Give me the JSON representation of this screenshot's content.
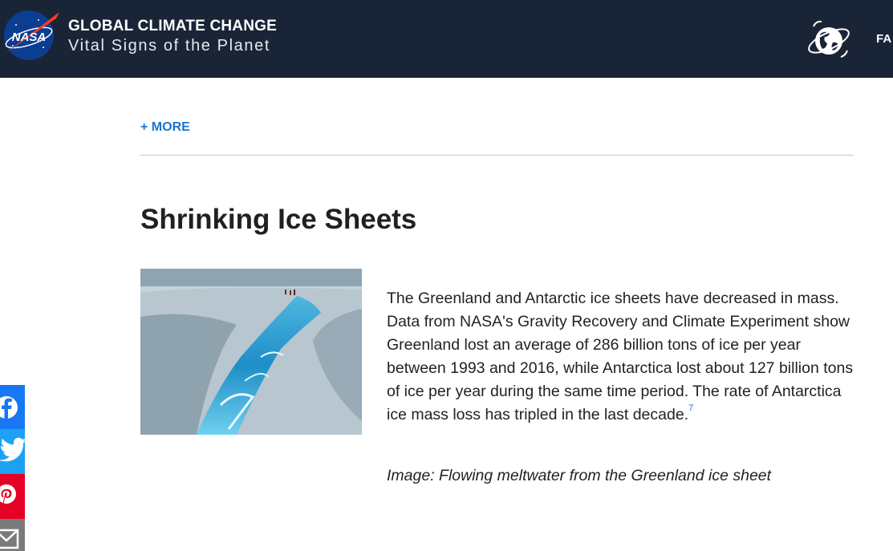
{
  "header": {
    "site_title": "GLOBAL CLIMATE CHANGE",
    "site_subtitle": "Vital Signs of the Planet",
    "logo_text": "NASA",
    "nav_partial": "FA"
  },
  "more_link": "+ MORE",
  "section": {
    "title": "Shrinking Ice Sheets",
    "body": "The Greenland and Antarctic ice sheets have decreased in mass. Data from NASA's Gravity Recovery and Climate Experiment show Greenland lost an average of 286 billion tons of ice per year between 1993 and 2016, while Antarctica lost about 127 billion tons of ice per year during the same time period. The rate of Antarctica ice mass loss has tripled in the last decade.",
    "footnote": "7",
    "caption": "Image: Flowing meltwater from the Greenland ice sheet"
  },
  "share": {
    "icons": [
      "facebook-icon",
      "twitter-icon",
      "pinterest-icon",
      "email-icon"
    ]
  },
  "colors": {
    "header_bg": "#1a2437",
    "link": "#1a76c9",
    "facebook": "#1877f2",
    "twitter": "#1da1f2",
    "pinterest": "#e60023",
    "email": "#7a7a7a"
  }
}
